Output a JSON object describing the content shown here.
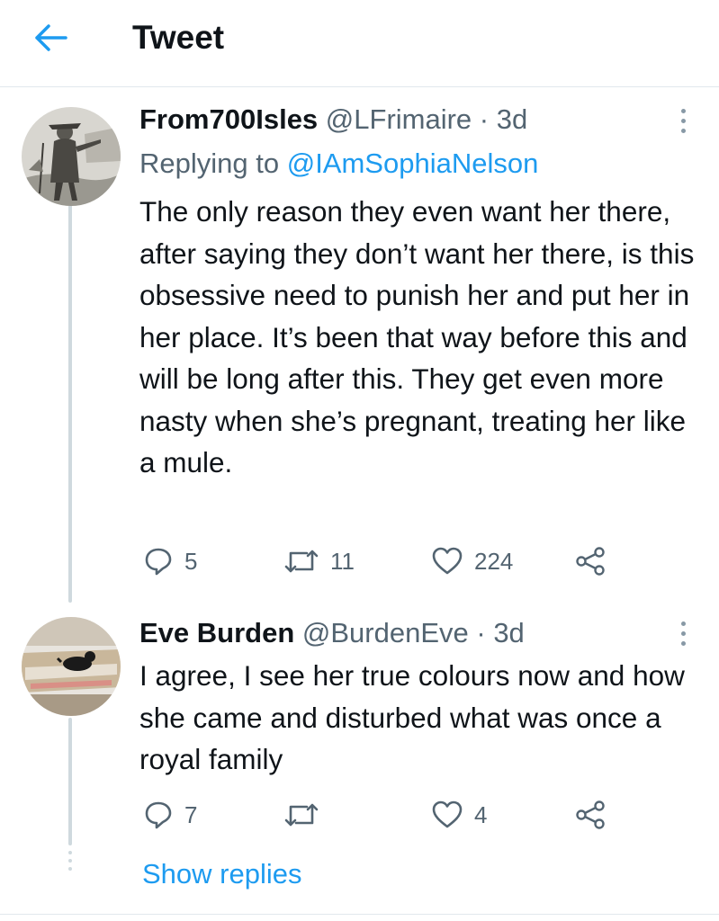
{
  "header": {
    "title": "Tweet"
  },
  "tweets": [
    {
      "display_name": "From700Isles",
      "handle": "@LFrimaire",
      "time": " · 3d",
      "replying_prefix": "Replying to ",
      "replying_to": "@IAmSophiaNelson",
      "text": "The only reason they even want her there, after saying they don’t want her there, is this obsessive need to punish her and put her in her place. It’s been that way before this and will be long after this. They get even more nasty when she’s pregnant, treating her like a mule.",
      "replies": "5",
      "retweets": "11",
      "likes": "224"
    },
    {
      "display_name": "Eve Burden",
      "handle": "@BurdenEve",
      "time": " · 3d",
      "text": "I agree, I see her true colours now and how she came and disturbed what was once a royal family",
      "replies": "7",
      "retweets": "",
      "likes": "4"
    }
  ],
  "show_replies": "Show replies",
  "colors": {
    "accent": "#1d9bf0",
    "muted": "#536471",
    "text": "#0f1419",
    "divider": "#e1e8ed"
  },
  "icons": {
    "back": "arrow-left-icon",
    "more": "more-vertical-icon",
    "reply": "reply-bubble-icon",
    "retweet": "retweet-icon",
    "like": "heart-icon",
    "share": "share-icon"
  }
}
